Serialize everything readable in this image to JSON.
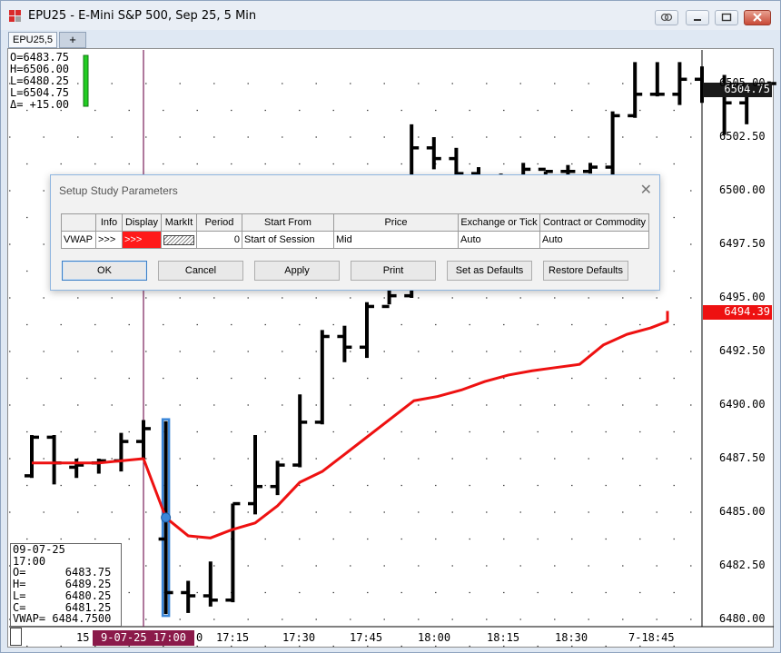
{
  "window": {
    "title": "EPU25 - E-Mini S&P 500, Sep 25, 5 Min",
    "tabs": [
      "EPU25,5",
      "+"
    ]
  },
  "ohlc_readout": {
    "open": "O=6483.75",
    "high": "H=6506.00",
    "low": "L=6480.25",
    "last": "L=6504.75",
    "delta": "Δ= +15.00"
  },
  "bar_info": {
    "date": "09-07-25",
    "time": "17:00",
    "o": "O=      6483.75",
    "h": "H=      6489.25",
    "l": "L=      6480.25",
    "c": "C=      6481.25",
    "vwap": "VWAP= 6484.7500"
  },
  "price_tags": {
    "last": "6504.75",
    "vwap": "6494.39"
  },
  "y_axis": [
    "6505.00",
    "6502.50",
    "6500.00",
    "6497.50",
    "6495.00",
    "6492.50",
    "6490.00",
    "6487.50",
    "6485.00",
    "6482.50",
    "6480.00"
  ],
  "x_axis": {
    "cursor_label": "9-07-25  17:00",
    "labels": [
      "15",
      "0",
      "17:15",
      "17:30",
      "17:45",
      "18:00",
      "18:15",
      "18:30",
      "7-18:45"
    ]
  },
  "dialog": {
    "title": "Setup Study Parameters",
    "headers": [
      "",
      "Info",
      "Display",
      "MarkIt",
      "Period",
      "Start From",
      "Price",
      "Exchange or Tick",
      "Contract or Commodity"
    ],
    "row": {
      "name": "VWAP",
      "info": ">>>",
      "display": ">>>",
      "period": "0",
      "start_from": "Start of Session",
      "price": "Mid",
      "exchange": "Auto",
      "contract": "Auto"
    },
    "buttons": [
      "OK",
      "Cancel",
      "Apply",
      "Print",
      "Set as Defaults",
      "Restore Defaults"
    ]
  },
  "colors": {
    "vwap_line": "#ee1111",
    "last_tag": "#1a1a1a",
    "vwap_tag": "#ee1111",
    "cursor_line": "#7a1f5a",
    "selected_bar": "#3a86d8"
  },
  "chart_data": {
    "type": "line",
    "bars_ohlc": [
      [
        6486.7,
        6488.6,
        6486.6,
        6488.5
      ],
      [
        6488.5,
        6488.6,
        6486.3,
        6487.3
      ],
      [
        6487.1,
        6487.5,
        6486.6,
        6487.2
      ],
      [
        6487.3,
        6487.5,
        6486.8,
        6487.4
      ],
      [
        6487.4,
        6488.7,
        6486.9,
        6488.3
      ],
      [
        6488.3,
        6489.3,
        6487.5,
        6488.9
      ],
      [
        6483.75,
        6489.25,
        6480.25,
        6481.25
      ],
      [
        6481.25,
        6481.8,
        6480.3,
        6481.1
      ],
      [
        6481.1,
        6482.7,
        6480.6,
        6480.9
      ],
      [
        6480.9,
        6485.4,
        6480.8,
        6485.4
      ],
      [
        6485.4,
        6488.6,
        6484.9,
        6486.2
      ],
      [
        6486.2,
        6487.4,
        6485.8,
        6487.2
      ],
      [
        6487.2,
        6490.5,
        6487.1,
        6489.2
      ],
      [
        6489.2,
        6493.5,
        6489.1,
        6493.2
      ],
      [
        6493.2,
        6493.7,
        6492.0,
        6492.7
      ],
      [
        6492.7,
        6494.8,
        6492.2,
        6494.6
      ],
      [
        6494.6,
        6496.7,
        6494.7,
        6495.1
      ],
      [
        6495.1,
        6503.1,
        6495.0,
        6502.0
      ],
      [
        6502.0,
        6502.5,
        6501.0,
        6501.5
      ],
      [
        6501.5,
        6502.0,
        6500.3,
        6500.8
      ],
      [
        6500.8,
        6501.1,
        6500.0,
        6500.4
      ],
      [
        6500.4,
        6500.8,
        6499.9,
        6500.5
      ],
      [
        6500.5,
        6501.3,
        6500.0,
        6501.0
      ],
      [
        6501.0,
        6500.9,
        6500.5,
        6500.9
      ],
      [
        6500.9,
        6501.2,
        6500.6,
        6500.9
      ],
      [
        6500.9,
        6501.3,
        6500.8,
        6501.1
      ],
      [
        6501.1,
        6503.7,
        6500.4,
        6503.5
      ],
      [
        6503.5,
        6506.0,
        6503.4,
        6504.5
      ],
      [
        6504.5,
        6506.0,
        6504.4,
        6504.5
      ],
      [
        6504.5,
        6506.0,
        6504.0,
        6505.2
      ],
      [
        6505.2,
        6505.8,
        6504.1,
        6504.7
      ],
      [
        6504.7,
        6505.4,
        6502.6,
        6504.1
      ],
      [
        6504.1,
        6504.8,
        6503.1,
        6504.5
      ],
      [
        6504.5,
        6505.1,
        6504.4,
        6505.0
      ],
      [
        6505.0,
        6504.9,
        6504.6,
        6504.75
      ]
    ],
    "vwap": [
      6487.3,
      6487.3,
      6487.3,
      6487.3,
      6487.4,
      6487.5,
      6484.75,
      6483.9,
      6483.8,
      6484.2,
      6484.5,
      6485.3,
      6486.4,
      6486.9,
      6487.7,
      6490.2,
      6490.4,
      6490.7,
      6491.1,
      6491.4,
      6491.6,
      6491.75,
      6491.9,
      6492.8,
      6493.3,
      6493.6,
      6493.9,
      6494.2,
      6494.39,
      6494.39
    ],
    "ylim": [
      6480.0,
      6506.5
    ]
  }
}
